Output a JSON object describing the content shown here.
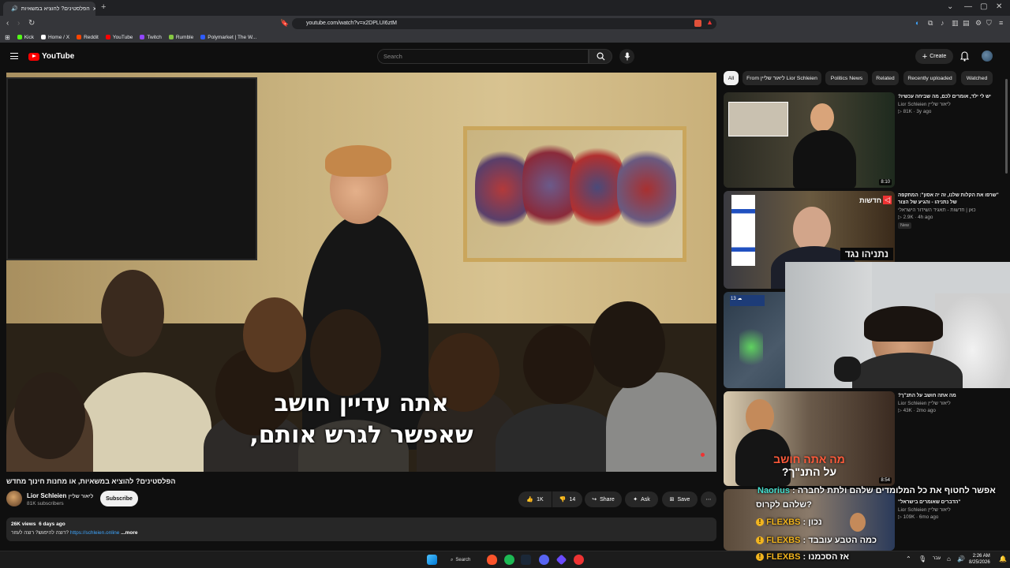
{
  "browser": {
    "tab_title": "הפלסטינים? להוציא במשאיות",
    "url": "youtube.com/watch?v=x2DPLUI6ztM",
    "bookmarks": [
      {
        "label": "Kick",
        "color": "#53fc18"
      },
      {
        "label": "Home / X",
        "color": "#ffffff"
      },
      {
        "label": "Reddit",
        "color": "#ff4500"
      },
      {
        "label": "YouTube",
        "color": "#ff0000"
      },
      {
        "label": "Twitch",
        "color": "#9146ff"
      },
      {
        "label": "Rumble",
        "color": "#85c742"
      },
      {
        "label": "Polymarket | The W...",
        "color": "#2e5cff"
      }
    ]
  },
  "header": {
    "logo": "YouTube",
    "search_placeholder": "Search",
    "create_label": "Create"
  },
  "video": {
    "subtitle_line1": "אתה עדיין חושב",
    "subtitle_line2": "שאפשר לגרש אותם,",
    "title": "הפלסטינים? להוציא במשאיות, או מחנות חינוך מחדש",
    "channel_name": "Lior Schleien",
    "channel_name_he": "ליאור שליין",
    "subscribers": "81K subscribers",
    "subscribe_label": "Subscribe",
    "likes": "1K",
    "dislikes": "14",
    "share_label": "Share",
    "ask_label": "Ask",
    "save_label": "Save",
    "views": "26K views",
    "age": "6 days ago",
    "desc_text": "רוצה להיפגש? רוצה לעזור?",
    "desc_link": "https://schleien.online",
    "more_label": "...more"
  },
  "chips": [
    "All",
    "From ליאור שליין Lior Schleien",
    "Politics News",
    "Related",
    "Recently uploaded",
    "Watched"
  ],
  "recommendations": [
    {
      "title": "יש לי ילד, אומרים לכם, מה שביחה עכשיו?",
      "channel": "Lior Schleien ליאור שליין",
      "views": "81K",
      "age": "3y ago",
      "duration": "8:10"
    },
    {
      "title": "\"שרפו את הקלות שלנו, זה יה אסון\": המתקפה של נתניהו - והגיע של הצור",
      "channel": "כאן | חדשות - תאגיד השידור הישראלי",
      "views": "2.9K",
      "age": "4h ago",
      "badge": "New",
      "overlay": "נתניהו נגד",
      "tag": "חדשות"
    },
    {
      "title": "",
      "channel": "",
      "views": "",
      "age": ""
    },
    {
      "title": "מה אתה חושב על התנ\"ך?",
      "channel": "Lior Schleien ליאור שליין",
      "views": "43K",
      "age": "2mo ago",
      "duration": "8:54",
      "overlay1": "מה אתה חושב",
      "overlay2": "על התנ\"ך?"
    },
    {
      "title": "\"הדברים שאומרים בישראל\"",
      "channel": "Lior Schleien ליאור שליין",
      "views": "109K",
      "age": "6mo ago"
    }
  ],
  "chat": [
    {
      "user": "Naorius",
      "text": ": אפשר לחטוף את כל המלומדים שלהם ולתת לחברה",
      "text2": "שלהם לקרוס?"
    },
    {
      "user": "FLEXBS",
      "text": ": נכון"
    },
    {
      "user": "FLEXBS",
      "text": ": כמה הטבע עובבד"
    },
    {
      "user": "FLEXBS",
      "text": ": אז הסכמנו"
    }
  ],
  "taskbar": {
    "search_label": "Search",
    "time": "2:26 AM",
    "date": "8/25/2026",
    "lang": "עבר"
  },
  "colors": {
    "yt_red": "#ff0000",
    "chat_user": "#f2b51f",
    "chat_user_alt": "#45e0d0"
  }
}
